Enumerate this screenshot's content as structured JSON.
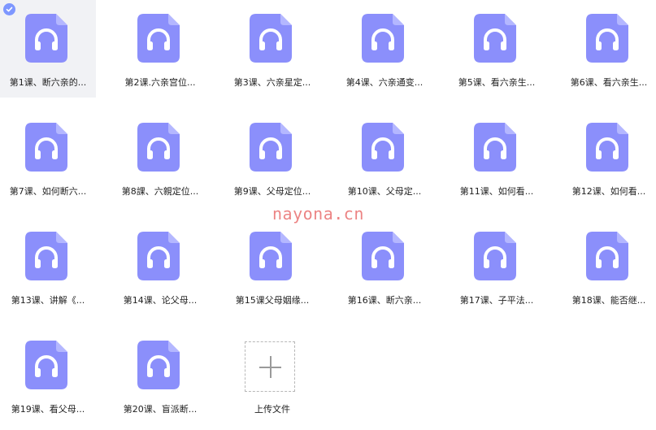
{
  "files": [
    {
      "name": "第1课、断六亲的...",
      "selected": true
    },
    {
      "name": "第2课.六亲宫位..."
    },
    {
      "name": "第3课、六亲星定..."
    },
    {
      "name": "第4课、六亲通变..."
    },
    {
      "name": "第5课、看六亲生..."
    },
    {
      "name": "第6课、看六亲生..."
    },
    {
      "name": "第7课、如何断六..."
    },
    {
      "name": "第8課、六親定位..."
    },
    {
      "name": "第9课、父母定位..."
    },
    {
      "name": "第10课、父母定..."
    },
    {
      "name": "第11课、如何看..."
    },
    {
      "name": "第12课、如何看..."
    },
    {
      "name": "第13课、讲解《..."
    },
    {
      "name": "第14课、论父母..."
    },
    {
      "name": "第15课父母姻缘..."
    },
    {
      "name": "第16课、断六亲..."
    },
    {
      "name": "第17课、子平法..."
    },
    {
      "name": "第18课、能否继..."
    },
    {
      "name": "第19课、看父母..."
    },
    {
      "name": "第20课、盲派断..."
    }
  ],
  "upload": {
    "label": "上传文件"
  },
  "watermark": "nayona.cn",
  "colors": {
    "icon": "#8b8ffb",
    "icon_fold": "#b4b7ff",
    "selected_bg": "#f1f2f5",
    "check": "#7e97ff",
    "watermark": "#e96f6f"
  },
  "icons": {
    "file": "headphones-icon",
    "check": "check-icon",
    "upload": "plus-icon"
  }
}
